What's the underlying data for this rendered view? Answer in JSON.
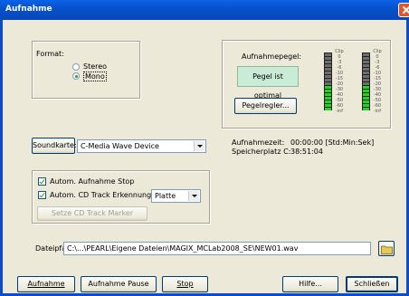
{
  "window": {
    "title": "Aufnahme"
  },
  "format": {
    "label": "Format:",
    "options": [
      "Stereo",
      "Mono"
    ],
    "selected": "Mono"
  },
  "level": {
    "group_label": "Aufnahmepegel:",
    "status": "Pegel ist optimal",
    "regler_button": "Pegelregler...",
    "scale": [
      "Clip",
      "0",
      "-3",
      "-6",
      "-10",
      "-15",
      "-20",
      "-30",
      "-40",
      "-50",
      "-60",
      "-inf"
    ],
    "left_level": 0.42,
    "right_level": 0.42,
    "colors": {
      "active": "#21d421",
      "inactive": "#6e6e6e",
      "status_bg": "#c9ecd6"
    }
  },
  "sound": {
    "button": "Soundkarte:",
    "device": "C-Media Wave Device"
  },
  "info": {
    "zeit_label": "Aufnahmezeit:",
    "zeit_value": "00:00:00 [Std:Min:Sek]",
    "platz_label": "Speicherplatz C:",
    "platz_value": "38:51:04"
  },
  "options": {
    "stop_label": "Autom. Aufnahme Stop",
    "track_label": "Autom. CD Track Erkennung",
    "track_select": "Platte",
    "marker_button": "Setze CD Track Marker"
  },
  "file": {
    "label": "Dateipfad:",
    "path": "C:\\...\\PEARL\\Eigene Dateien\\MAGIX_MCLab2008_SE\\NEW01.wav"
  },
  "buttons": {
    "aufnahme": "Aufnahme",
    "pause": "Aufnahme Pause",
    "stop": "Stop",
    "hilfe": "Hilfe...",
    "schliessen": "Schließen"
  }
}
